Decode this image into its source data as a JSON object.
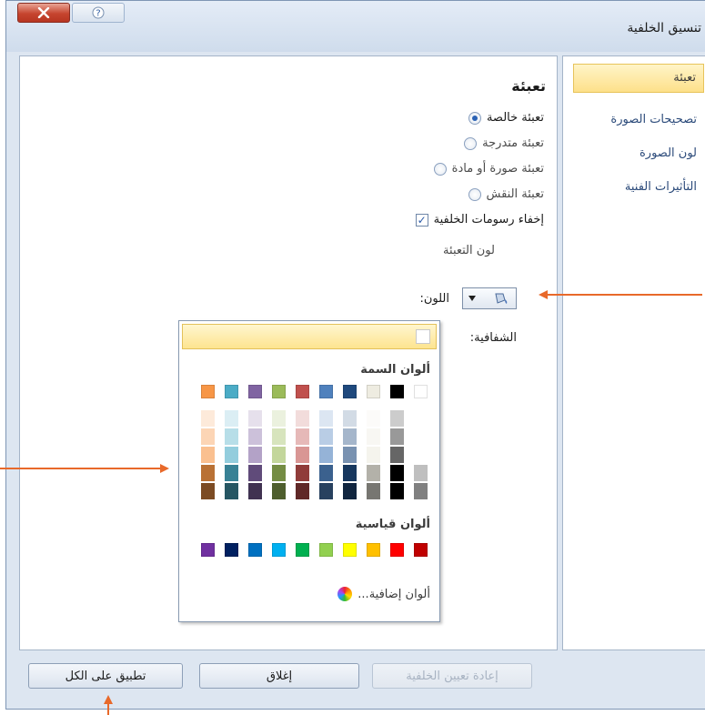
{
  "dialog": {
    "title": "تنسيق الخلفية",
    "close_icon": "close-icon",
    "help_icon": "help-icon"
  },
  "sidebar": {
    "items": [
      {
        "label": "تعبئة",
        "selected": true
      },
      {
        "label": "تصحيحات الصورة",
        "selected": false
      },
      {
        "label": "لون الصورة",
        "selected": false
      },
      {
        "label": "التأثيرات الفنية",
        "selected": false
      }
    ]
  },
  "fill": {
    "heading": "تعبئة",
    "options": [
      {
        "label": "تعبئة خالصة",
        "selected": true
      },
      {
        "label": "تعبئة متدرجة",
        "selected": false
      },
      {
        "label": "تعبئة صورة أو مادة",
        "selected": false
      },
      {
        "label": "تعبئة النقش",
        "selected": false
      }
    ],
    "hide_background_graphics": {
      "label": "إخفاء رسومات الخلفية",
      "checked": true
    },
    "fill_color_label": "لون التعبئة",
    "color_label": "اللون:",
    "transparency_label": "الشفافية:"
  },
  "palette": {
    "theme_heading": "ألوان السمة",
    "standard_heading": "ألوان قياسية",
    "more_colors": "ألوان إضافية...",
    "theme_colors": [
      "#ffffff",
      "#000000",
      "#eeece1",
      "#1f497d",
      "#4f81bd",
      "#c0504d",
      "#9bbb59",
      "#8064a2",
      "#4bacc6",
      "#f79646"
    ],
    "standard_colors": [
      "#c00000",
      "#ff0000",
      "#ffc000",
      "#ffff00",
      "#92d050",
      "#00b050",
      "#00b0f0",
      "#0070c0",
      "#002060",
      "#7030a0"
    ]
  },
  "footer": {
    "reset_label": "إعادة تعيين الخلفية",
    "close_label": "إغلاق",
    "apply_all_label": "تطبيق على الكل"
  },
  "colors": {
    "annotation_arrow": "#e8692a",
    "selection_highlight": "#fde08a"
  }
}
